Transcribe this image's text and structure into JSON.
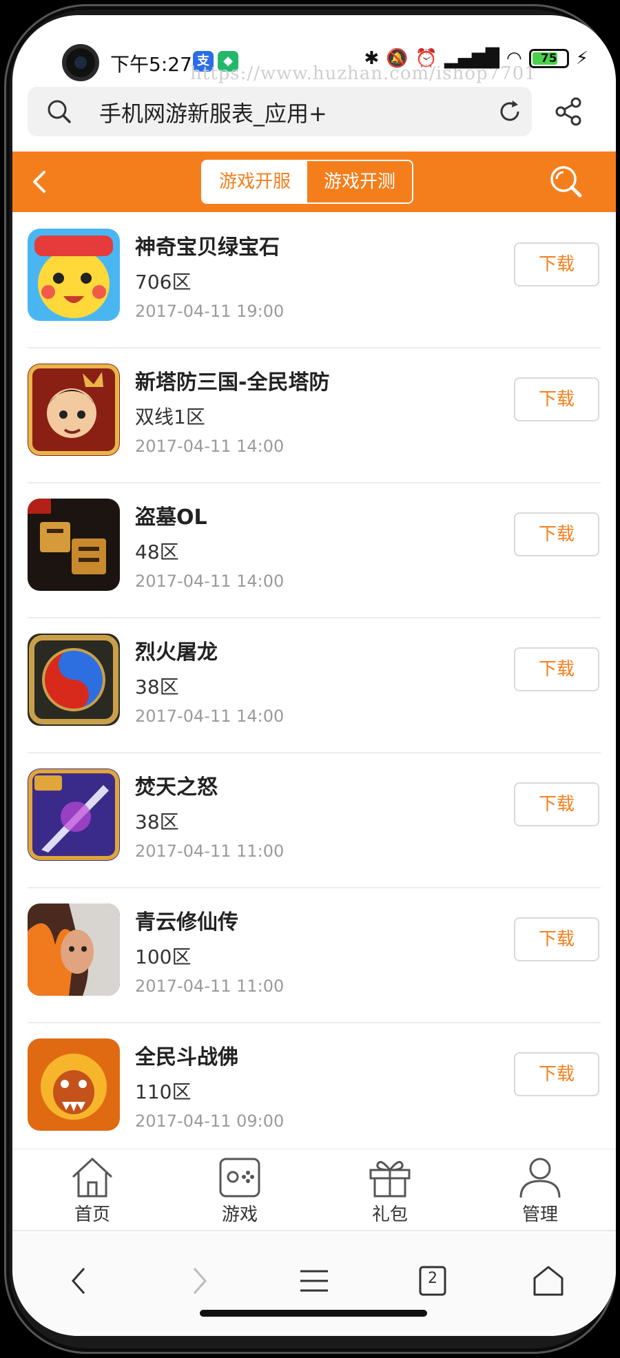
{
  "status_bar": {
    "time": "下午5:27",
    "badge_1": "支",
    "badge_2": "◆",
    "battery_level": "75",
    "watermark": "https://www.huzhan.com/ishop7701"
  },
  "browser": {
    "url_text": "手机网游新服表_应用+",
    "tab_count": "2"
  },
  "header": {
    "tabs": [
      {
        "label": "游戏开服",
        "selected": false
      },
      {
        "label": "游戏开测",
        "selected": true
      }
    ]
  },
  "games": [
    {
      "name": "神奇宝贝绿宝石",
      "zone": "706区",
      "time": "2017-04-11 19:00",
      "icon": "pikachu-icon",
      "action": "下载"
    },
    {
      "name": "新塔防三国-全民塔防",
      "zone": "双线1区",
      "time": "2017-04-11 14:00",
      "icon": "three-kingdoms-hero-icon",
      "action": "下载"
    },
    {
      "name": "盗墓OL",
      "zone": "48区",
      "time": "2017-04-11 14:00",
      "icon": "tomb-raider-icon",
      "action": "下载"
    },
    {
      "name": "烈火屠龙",
      "zone": "38区",
      "time": "2017-04-11 14:00",
      "icon": "yin-yang-icon",
      "action": "下载"
    },
    {
      "name": "焚天之怒",
      "zone": "38区",
      "time": "2017-04-11 11:00",
      "icon": "sword-3v3-icon",
      "action": "下载"
    },
    {
      "name": "青云修仙传",
      "zone": "100区",
      "time": "2017-04-11 11:00",
      "icon": "fire-warrior-icon",
      "action": "下载"
    },
    {
      "name": "全民斗战佛",
      "zone": "110区",
      "time": "2017-04-11 09:00",
      "icon": "monkey-king-icon",
      "action": "下载"
    }
  ],
  "tab_bar": {
    "items": [
      {
        "label": "首页",
        "icon": "home-icon"
      },
      {
        "label": "游戏",
        "icon": "gamepad-icon"
      },
      {
        "label": "礼包",
        "icon": "gift-icon"
      },
      {
        "label": "管理",
        "icon": "user-icon"
      }
    ]
  },
  "theme": {
    "accent": "#f57e1c",
    "text": "#222222",
    "muted": "#9a9a9a"
  }
}
